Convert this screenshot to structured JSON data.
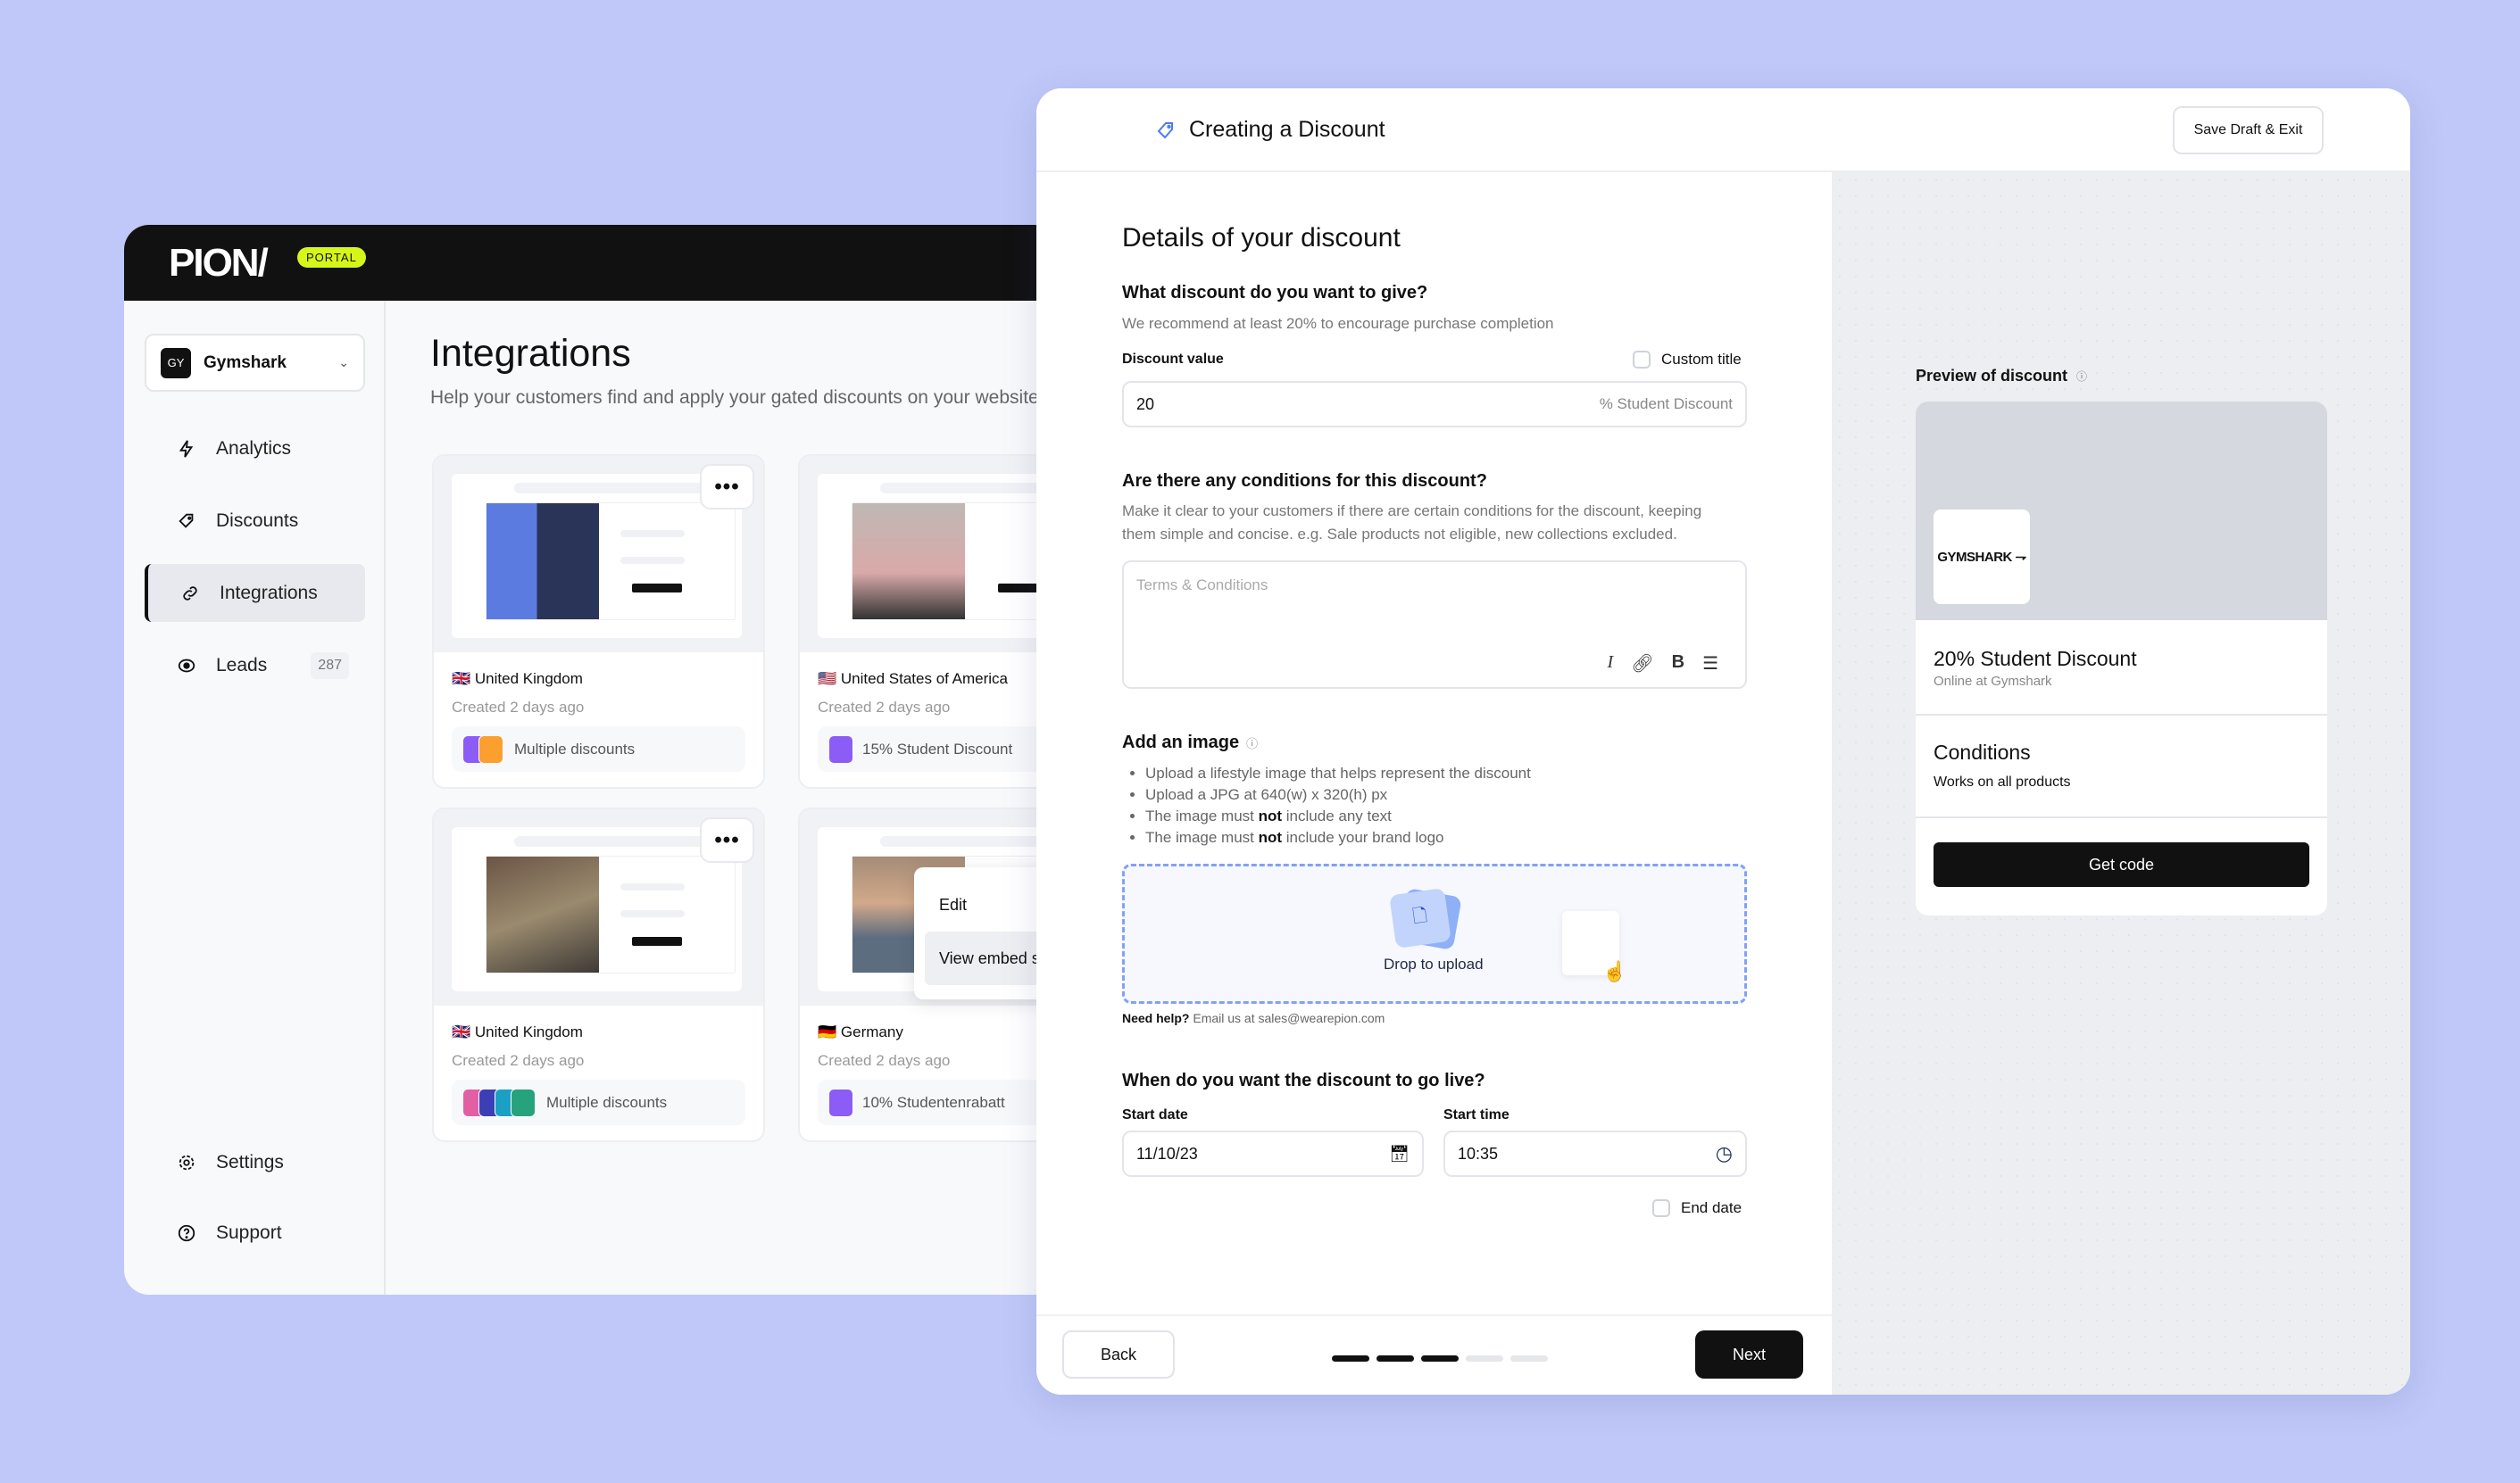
{
  "portal": {
    "logo": "PION/",
    "badge": "PORTAL",
    "brand": {
      "initials": "GY",
      "name": "Gymshark"
    },
    "nav": [
      {
        "label": "Analytics",
        "icon": "lightning-icon"
      },
      {
        "label": "Discounts",
        "icon": "tag-icon"
      },
      {
        "label": "Integrations",
        "icon": "link-icon",
        "active": true
      },
      {
        "label": "Leads",
        "icon": "eye-icon",
        "count": "287"
      }
    ],
    "nav_bottom": [
      {
        "label": "Settings",
        "icon": "gear-icon"
      },
      {
        "label": "Support",
        "icon": "help-icon"
      }
    ],
    "title": "Integrations",
    "subtitle": "Help your customers find and apply your gated discounts on your website",
    "cards": [
      {
        "flag": "🇬🇧",
        "country": "United Kingdom",
        "created": "Created 2 days ago",
        "discount": "Multiple discounts"
      },
      {
        "flag": "🇺🇸",
        "country": "United States of America",
        "created": "Created 2 days ago",
        "discount": "15% Student Discount"
      },
      {
        "flag": "🇬🇧",
        "country": "United Kingdom",
        "created": "Created 2 days ago",
        "discount": "Multiple discounts"
      },
      {
        "flag": "🇩🇪",
        "country": "Germany",
        "created": "Created 2 days ago",
        "discount": "10% Studentenrabatt"
      }
    ],
    "context_menu": {
      "edit": "Edit",
      "view_embed": "View embed s"
    }
  },
  "modal": {
    "title": "Creating a Discount",
    "save_draft": "Save Draft & Exit",
    "heading": "Details of your discount",
    "discount": {
      "question": "What discount do you want to give?",
      "hint": "We recommend at least 20% to encourage purchase completion",
      "label": "Discount value",
      "custom_title": "Custom title",
      "value": "20",
      "suffix": "% Student Discount"
    },
    "conditions": {
      "question": "Are there any conditions for this discount?",
      "hint": "Make it clear to your customers if there are certain conditions for the discount, keeping them simple and concise. e.g. Sale products not eligible, new collections excluded.",
      "placeholder": "Terms & Conditions"
    },
    "image": {
      "heading": "Add an image",
      "bullets": [
        "Upload a lifestyle image that helps represent the discount",
        "Upload a JPG at 640(w) x 320(h) px"
      ],
      "bullet3": {
        "pre": "The image must ",
        "bold": "not",
        "post": " include any text"
      },
      "bullet4": {
        "pre": "The image must ",
        "bold": "not",
        "post": " include your brand logo"
      },
      "drop_label": "Drop to upload",
      "help_bold": "Need help?",
      "help_text": "Email us at sales@wearepion.com"
    },
    "schedule": {
      "question": "When do you want the discount to go live?",
      "start_date_label": "Start date",
      "start_date": "11/10/23",
      "start_time_label": "Start time",
      "start_time": "10:35",
      "end_date": "End date"
    },
    "footer": {
      "back": "Back",
      "next": "Next",
      "step": 3,
      "total_steps": 5
    },
    "preview": {
      "label": "Preview of discount",
      "logo": "GYMSHARK",
      "title": "20% Student Discount",
      "subtitle": "Online at Gymshark",
      "conditions_title": "Conditions",
      "conditions_text": "Works on all products",
      "cta": "Get code"
    }
  },
  "colors": {
    "background": "#bfc8f8",
    "accent": "#d6f619",
    "dropzone": "#82a2f5",
    "primary": "#111111"
  }
}
